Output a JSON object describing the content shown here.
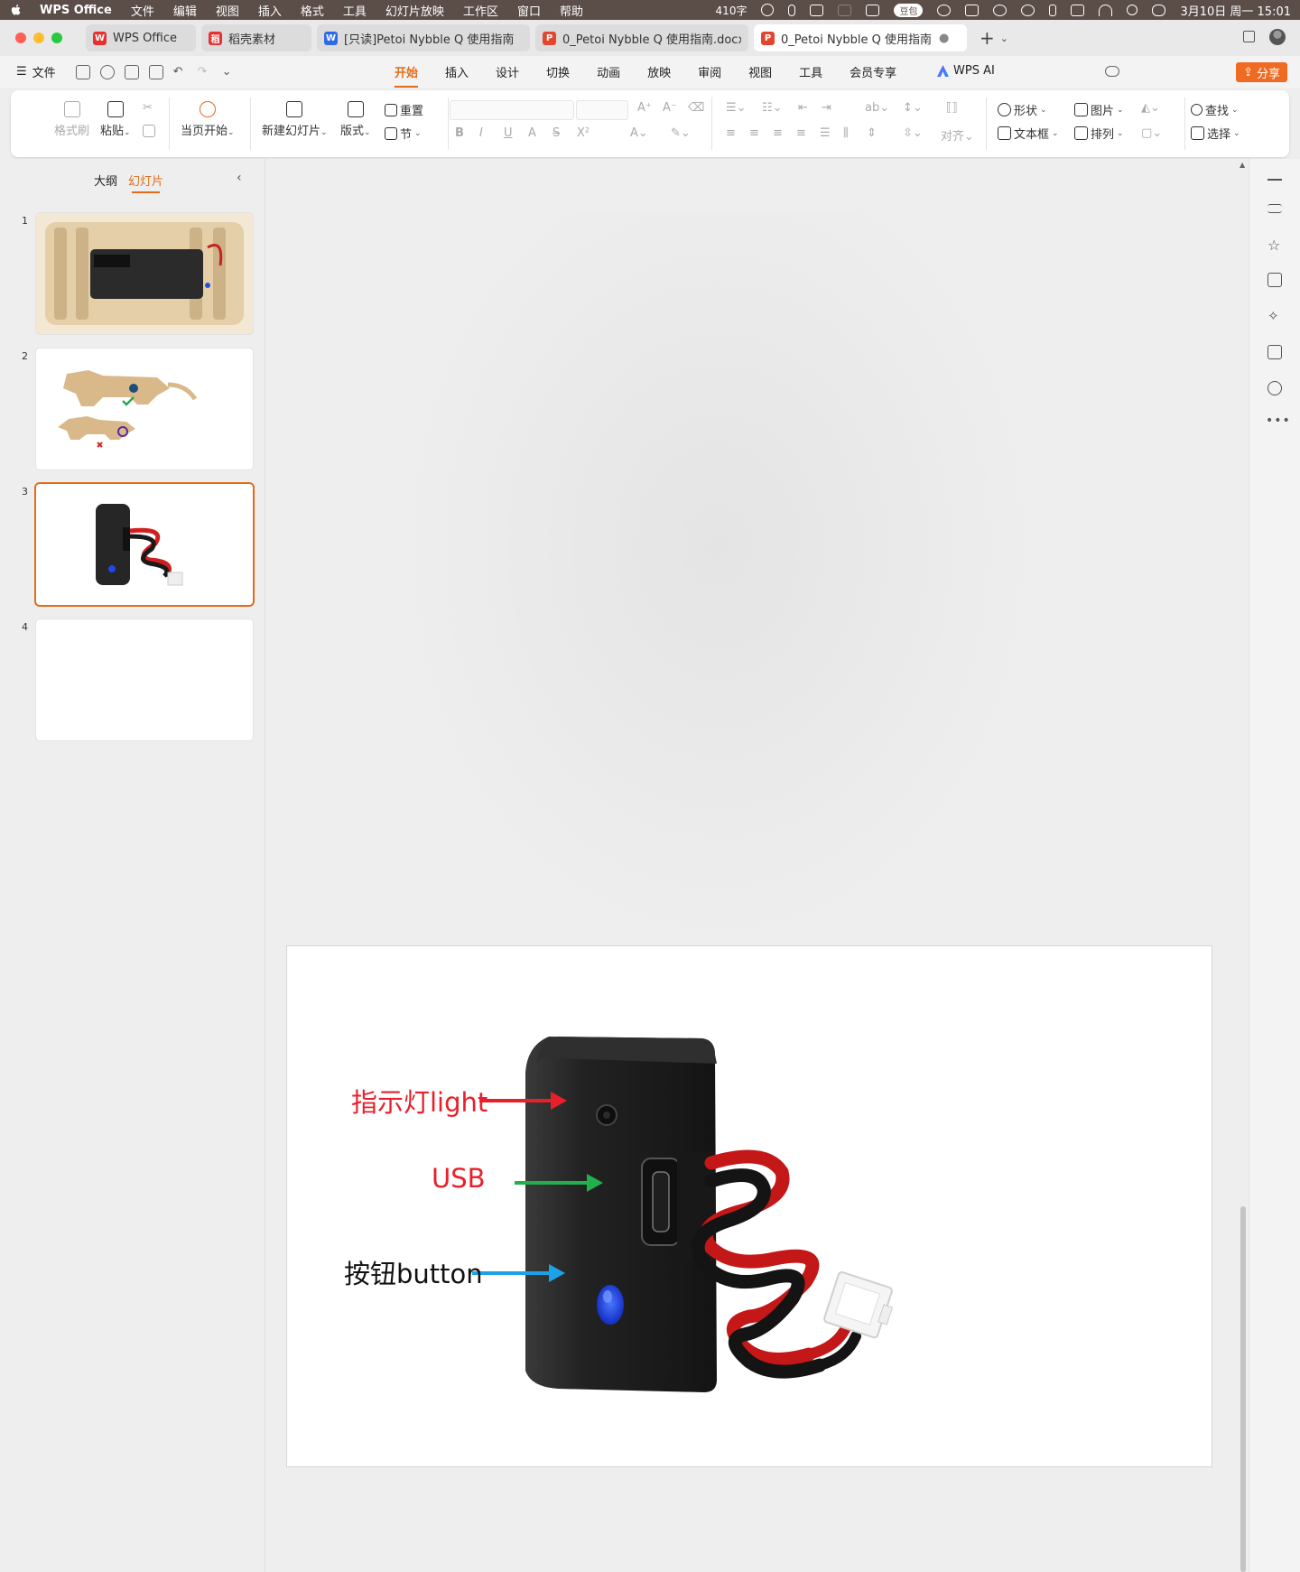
{
  "menubar": {
    "items": [
      "WPS Office",
      "文件",
      "编辑",
      "视图",
      "插入",
      "格式",
      "工具",
      "幻灯片放映",
      "工作区",
      "窗口",
      "帮助"
    ],
    "word_count": "410字",
    "pill": "豆包",
    "datetime": "3月10日 周一 15:01"
  },
  "tabs": [
    {
      "label": "WPS Office",
      "color": "#e8312f",
      "logo": "W"
    },
    {
      "label": "稻壳素材",
      "color": "#e8312f",
      "logo": "稻"
    },
    {
      "label": "[只读]Petoi  Nybble Q 使用指南",
      "color": "#2f6ae5",
      "logo": "W"
    },
    {
      "label": "0_Petoi  Nybble Q 使用指南.docx",
      "color": "#e2462f",
      "logo": "P"
    },
    {
      "label": "0_Petoi  Nybble Q 使用指南",
      "color": "#e2462f",
      "logo": "P"
    }
  ],
  "menurow": {
    "file": "文件",
    "ribbon_tabs": [
      "开始",
      "插入",
      "设计",
      "切换",
      "动画",
      "放映",
      "审阅",
      "视图",
      "工具",
      "会员专享"
    ],
    "ai": "WPS AI",
    "share": "分享"
  },
  "ribbon": {
    "format_painter": "格式刷",
    "paste": "粘贴",
    "from_current": "当页开始",
    "new_slide": "新建幻灯片",
    "layout": "版式",
    "reset": "重置",
    "section": "节",
    "align": "对齐",
    "shape": "形状",
    "picture": "图片",
    "textbox": "文本框",
    "arrange": "排列",
    "find": "查找",
    "select": "选择",
    "font_buttons": [
      "B",
      "I",
      "U",
      "A",
      "S",
      "X²"
    ]
  },
  "leftpanel": {
    "tab_outline": "大纲",
    "tab_slides": "幻灯片",
    "slides": [
      "1",
      "2",
      "3",
      "4"
    ]
  },
  "slide": {
    "label_light": "指示灯light",
    "label_usb": "USB",
    "label_button": "按钮button"
  },
  "colors": {
    "accent": "#e36c1b",
    "light_arrow": "#e8202a",
    "usb_arrow": "#21b04b",
    "button_arrow": "#1aa3e8"
  }
}
